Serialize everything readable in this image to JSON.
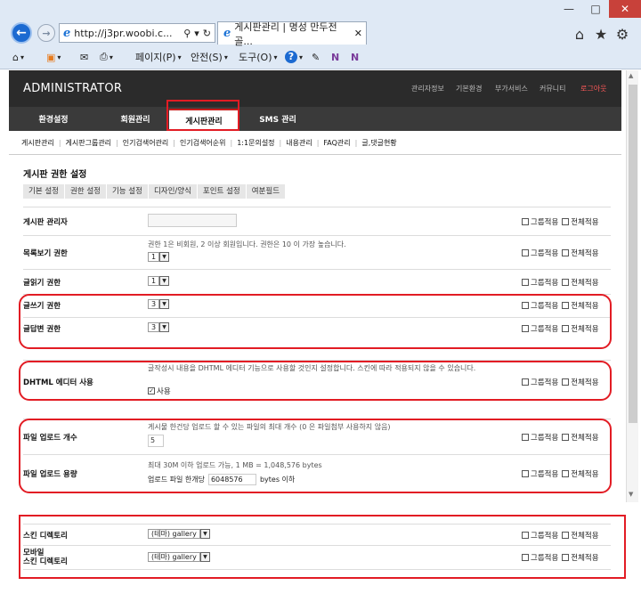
{
  "browser": {
    "address": "http://j3pr.woobi.c...",
    "tab_title": "게시판관리 | 명성 만두전골...",
    "toolbar": {
      "page": "페이지(P)",
      "safety": "안전(S)",
      "tools": "도구(O)"
    }
  },
  "admin": {
    "brand": "ADMINISTRATOR",
    "top_links": [
      "관리자정보",
      "기본환경",
      "부가서비스",
      "커뮤니티",
      "로그아웃"
    ],
    "main_tabs": [
      "환경설정",
      "회원관리",
      "게시판관리",
      "SMS 관리"
    ],
    "active_tab": "게시판관리",
    "sub_nav": [
      "게시판관리",
      "게시판그룹관리",
      "인기검색어관리",
      "인기검색어순위",
      "1:1문의설정",
      "내용관리",
      "FAQ관리",
      "글,댓글현황"
    ]
  },
  "section": {
    "title": "게시판 권한 설정",
    "tabs": [
      "기본 설정",
      "권한 설정",
      "기능 설정",
      "디자인/양식",
      "포인트 설정",
      "여분필드"
    ]
  },
  "check_labels": {
    "group": "그룹적용",
    "all": "전체적용"
  },
  "rows": {
    "manager": {
      "label": "게시판 관리자"
    },
    "list_perm": {
      "label": "목록보기 권한",
      "desc": "권한 1은 비회원, 2 이상 회원입니다. 권한은 10 이 가장 높습니다.",
      "value": "1"
    },
    "read_perm": {
      "label": "글읽기 권한",
      "value": "1"
    },
    "write_perm": {
      "label": "글쓰기 권한",
      "value": "3"
    },
    "reply_perm": {
      "label": "글답변 권한",
      "value": "3"
    },
    "dhtml": {
      "label": "DHTML 에디터 사용",
      "desc": "글작성시 내용을 DHTML 에디터 기능으로 사용할 것인지 설정합니다. 스킨에 따라 적용되지 않을 수 있습니다.",
      "checkbox_label": "사용"
    },
    "upload_count": {
      "label": "파일 업로드 개수",
      "desc": "게시물 한건당 업로드 할 수 있는 파일의 최대 개수 (0 은 파일첨부 사용하지 않음)",
      "value": "5"
    },
    "upload_size": {
      "label": "파일 업로드 용량",
      "desc": "최대 30M 이하 업로드 가능, 1 MB = 1,048,576 bytes",
      "prefix": "업로드 파일 한개당",
      "value": "6048576",
      "suffix": "bytes 이하"
    },
    "skin_dir": {
      "label": "스킨 디렉토리",
      "value": "(테마) gallery"
    },
    "mobile_skin_dir": {
      "label1": "모바일",
      "label2": "스킨 디렉토리",
      "value": "(테마) gallery"
    }
  },
  "colors": {
    "highlight": "#e21c24",
    "header_bg": "#2b2b2b",
    "logout": "#ff5a5a"
  }
}
